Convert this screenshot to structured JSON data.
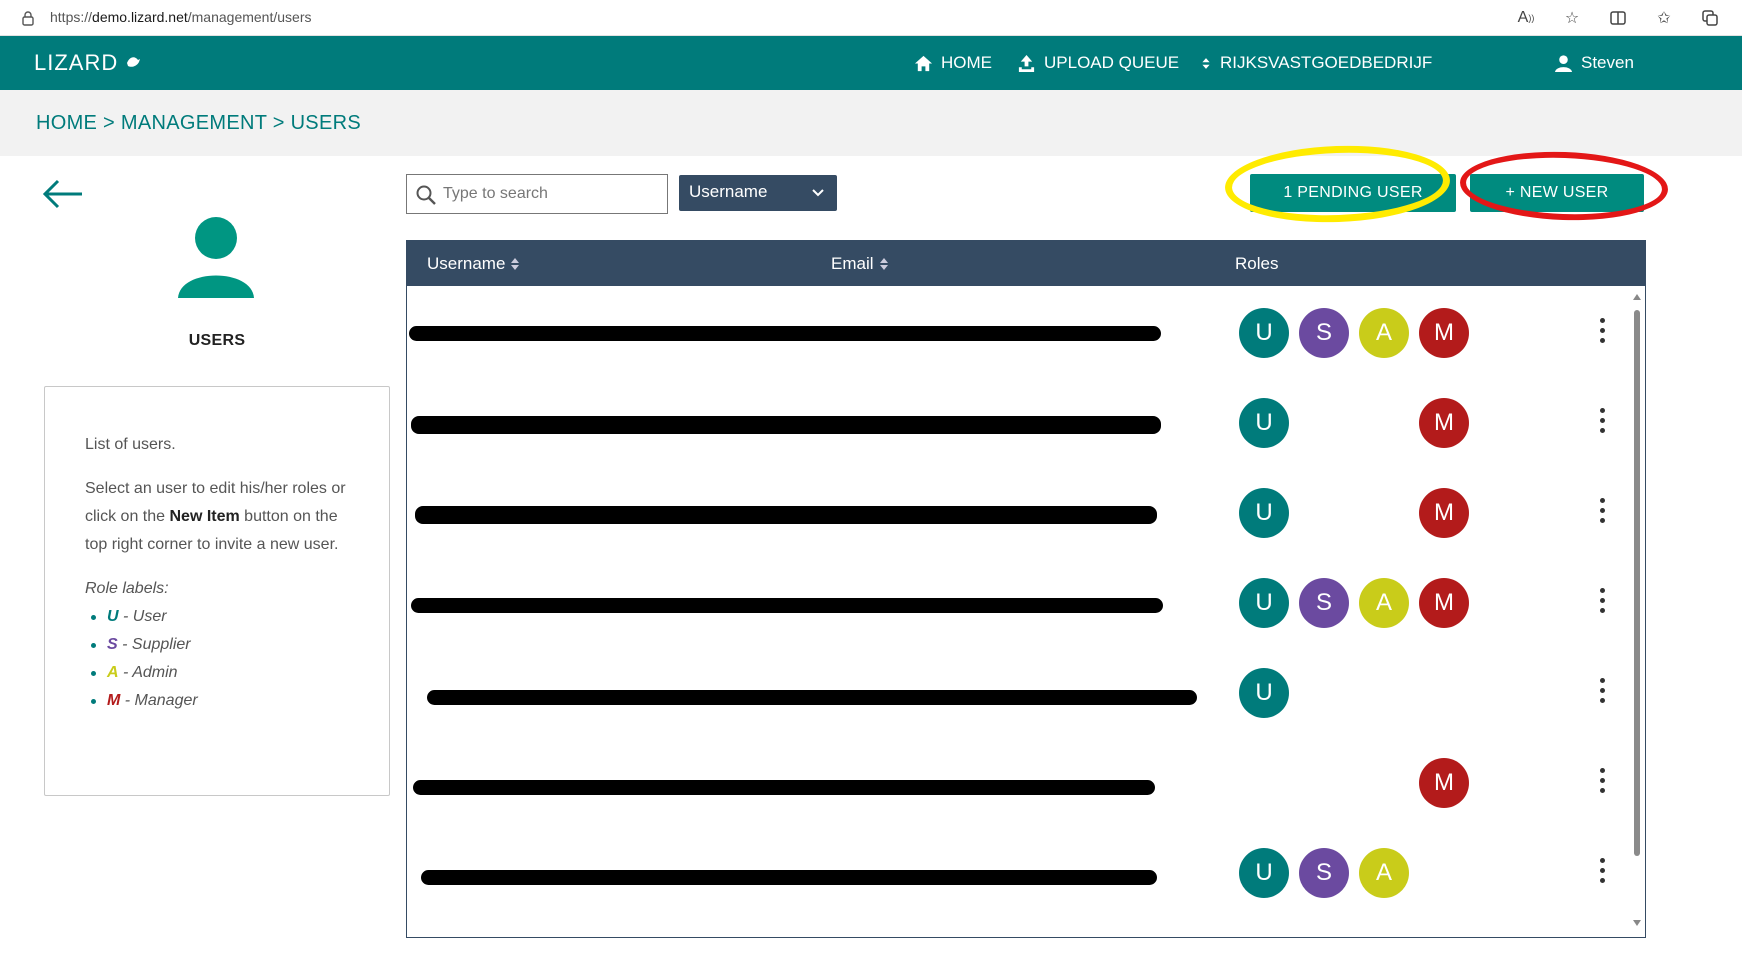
{
  "browser": {
    "url_prefix": "https://",
    "url_domain": "demo.lizard.net",
    "url_path": "/management/users"
  },
  "header": {
    "logo": "LIZARD",
    "nav": [
      {
        "label": "HOME",
        "icon": "home-icon"
      },
      {
        "label": "UPLOAD QUEUE",
        "icon": "upload-icon"
      },
      {
        "label": "RIJKSVASTGOEDBEDRIJF",
        "icon": "sort-icon"
      }
    ],
    "user": "Steven"
  },
  "breadcrumb": "HOME > MANAGEMENT > USERS",
  "sidebar": {
    "title": "USERS",
    "intro": "List of users.",
    "help_before": "Select an user to edit his/her roles or click on the ",
    "help_bold": "New Item",
    "help_after": " button on the top right corner to invite a new user.",
    "roles_title": "Role labels:",
    "roles": [
      {
        "letter": "U",
        "label": " - User",
        "color": "#007b7b"
      },
      {
        "letter": "S",
        "label": " - Supplier",
        "color": "#6b4aa0"
      },
      {
        "letter": "A",
        "label": " - Admin",
        "color": "#c9cc1a"
      },
      {
        "letter": "M",
        "label": " - Manager",
        "color": "#b31b1b"
      }
    ]
  },
  "toolbar": {
    "search_placeholder": "Type to search",
    "dropdown_value": "Username",
    "pending_label": "1 PENDING USER",
    "new_label": "+ NEW USER"
  },
  "table": {
    "columns": [
      "Username",
      "Email",
      "Roles"
    ],
    "rows": [
      {
        "roles": [
          "U",
          "S",
          "A",
          "M"
        ]
      },
      {
        "roles": [
          "U",
          "M"
        ]
      },
      {
        "roles": [
          "U",
          "M"
        ]
      },
      {
        "roles": [
          "U",
          "S",
          "A",
          "M"
        ]
      },
      {
        "roles": [
          "U"
        ]
      },
      {
        "roles": [
          "M"
        ]
      },
      {
        "roles": [
          "U",
          "S",
          "A"
        ]
      }
    ]
  },
  "colors": {
    "accent": "#007b7b",
    "table_header": "#354b63",
    "button": "#008b7f",
    "highlight_yellow": "#ffeb00",
    "highlight_red": "#e31717"
  }
}
